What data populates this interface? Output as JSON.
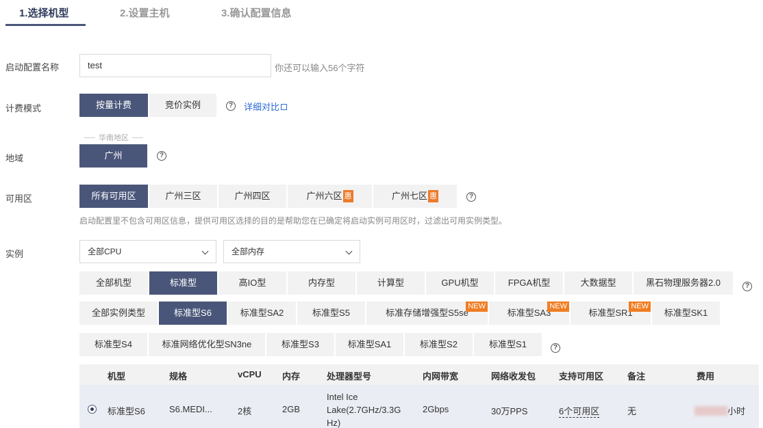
{
  "steps": [
    "1.选择机型",
    "2.设置主机",
    "3.确认配置信息"
  ],
  "name_field": {
    "label": "启动配置名称",
    "value": "test",
    "hint": "你还可以输入56个字符"
  },
  "billing": {
    "label": "计费模式",
    "options": [
      "按量计费",
      "竞价实例"
    ],
    "selected": "按量计费",
    "compare_link": "详细对比"
  },
  "region": {
    "label": "地域",
    "caption": "华南地区",
    "options": [
      "广州"
    ],
    "selected": "广州"
  },
  "zone": {
    "label": "可用区",
    "options": [
      "所有可用区",
      "广州三区",
      "广州四区",
      "广州六区",
      "广州七区"
    ],
    "badge": "惠",
    "selected": "所有可用区",
    "hint": "启动配置里不包含可用区信息，提供可用区选择的目的是帮助您在已确定将启动实例可用区时，过滤出可用实例类型。"
  },
  "instance": {
    "label": "实例",
    "cpu_select": "全部CPU",
    "mem_select": "全部内存",
    "families": [
      "全部机型",
      "标准型",
      "高IO型",
      "内存型",
      "计算型",
      "GPU机型",
      "FPGA机型",
      "大数据型",
      "黑石物理服务器2.0"
    ],
    "family_selected": "标准型",
    "types_row1": [
      "全部实例类型",
      "标准型S6",
      "标准型SA2",
      "标准型S5",
      "标准存储增强型S5se",
      "标准型SA3",
      "标准型SR1",
      "标准型SK1"
    ],
    "types_row2": [
      "标准型S4",
      "标准网络优化型SN3ne",
      "标准型S3",
      "标准型SA1",
      "标准型S2",
      "标准型S1"
    ],
    "type_selected": "标准型S6",
    "new_badge": "NEW"
  },
  "table": {
    "headers": [
      "机型",
      "规格",
      "vCPU",
      "内存",
      "处理器型号",
      "内网带宽",
      "网络收发包",
      "支持可用区",
      "备注",
      "费用"
    ],
    "row": {
      "model": "标准型S6",
      "spec": "S6.MEDI...",
      "vcpu": "2核",
      "memory": "2GB",
      "cpu_model_1": "Intel Ice",
      "cpu_model_2": "Lake(2.7GHz/3.3G",
      "cpu_model_3": "Hz)",
      "bandwidth": "2Gbps",
      "pps": "30万PPS",
      "zones": "6个可用区",
      "note": "无",
      "price_unit": "小时"
    }
  },
  "help_glyph": "?",
  "colors": {
    "accent": "#4a5679",
    "link": "#2a6ad8",
    "badge": "#ec7a2a"
  }
}
